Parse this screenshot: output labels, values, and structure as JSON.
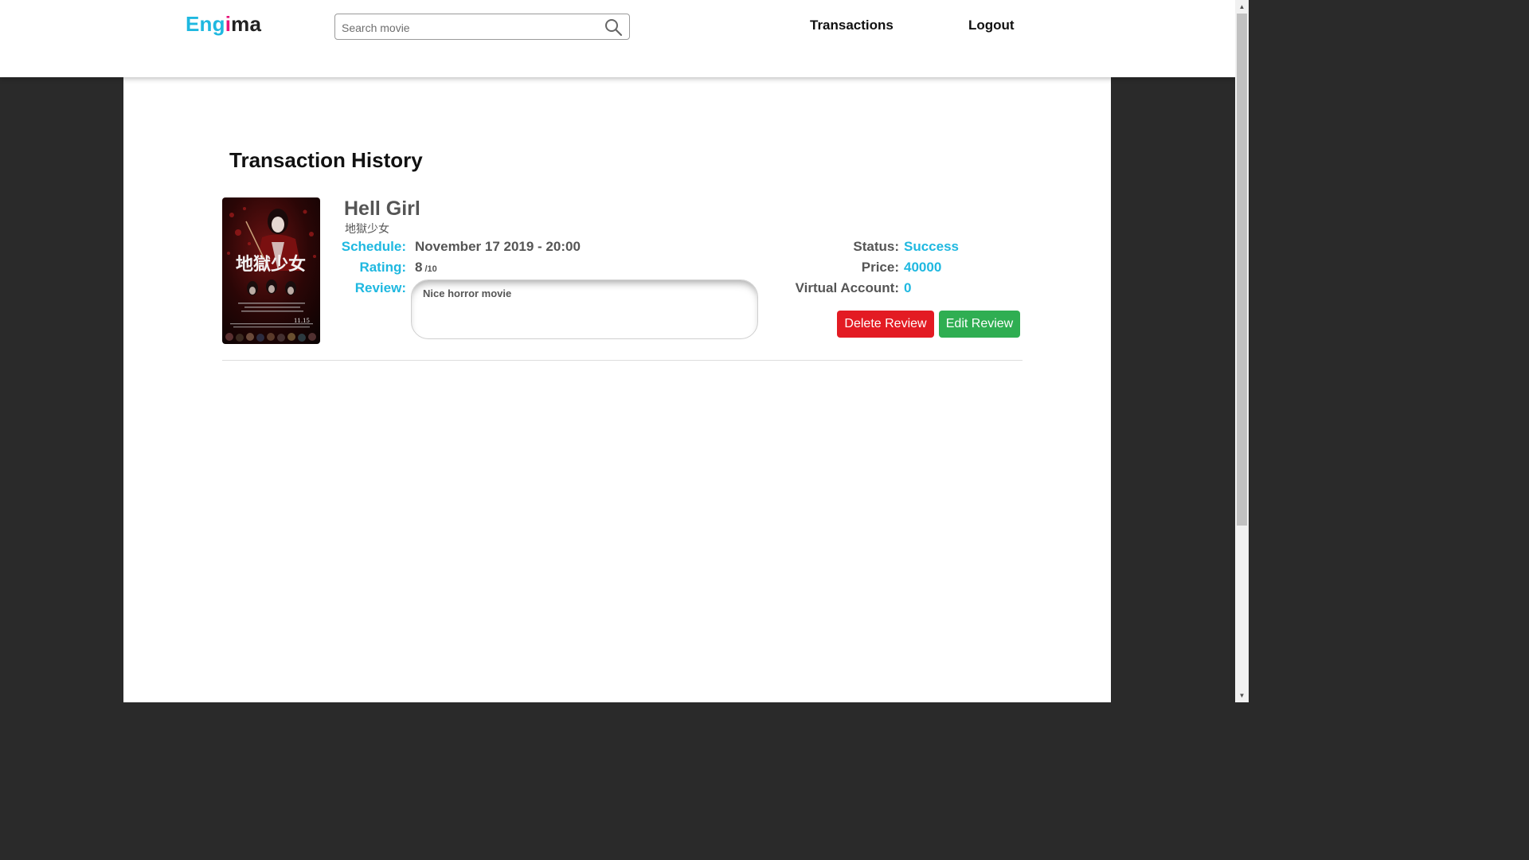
{
  "header": {
    "logo": {
      "part1": "Eng",
      "part2": "i",
      "part3": "ma"
    },
    "search": {
      "placeholder": "Search movie",
      "value": ""
    },
    "nav": {
      "transactions": "Transactions",
      "logout": "Logout"
    }
  },
  "main": {
    "page_title": "Transaction History",
    "transactions": [
      {
        "poster": {
          "title_text": "地獄少女",
          "date_text": "11.15"
        },
        "title": "Hell Girl",
        "subtitle": "地獄少女",
        "schedule_label": "Schedule:",
        "schedule": "November 17 2019 - 20:00",
        "rating_label": "Rating:",
        "rating": "8",
        "rating_max": "/10",
        "review_label": "Review:",
        "review": "Nice horror movie",
        "status_label": "Status:",
        "status": "Success",
        "price_label": "Price:",
        "price": "40000",
        "va_label": "Virtual Account:",
        "va": "0",
        "delete_label": "Delete Review",
        "edit_label": "Edit Review"
      }
    ]
  },
  "colors": {
    "accent": "#1fb8e0",
    "logo_pink": "#e8137a",
    "delete": "#e31b23",
    "edit": "#2fae52",
    "backdrop": "#2a2a2a"
  }
}
